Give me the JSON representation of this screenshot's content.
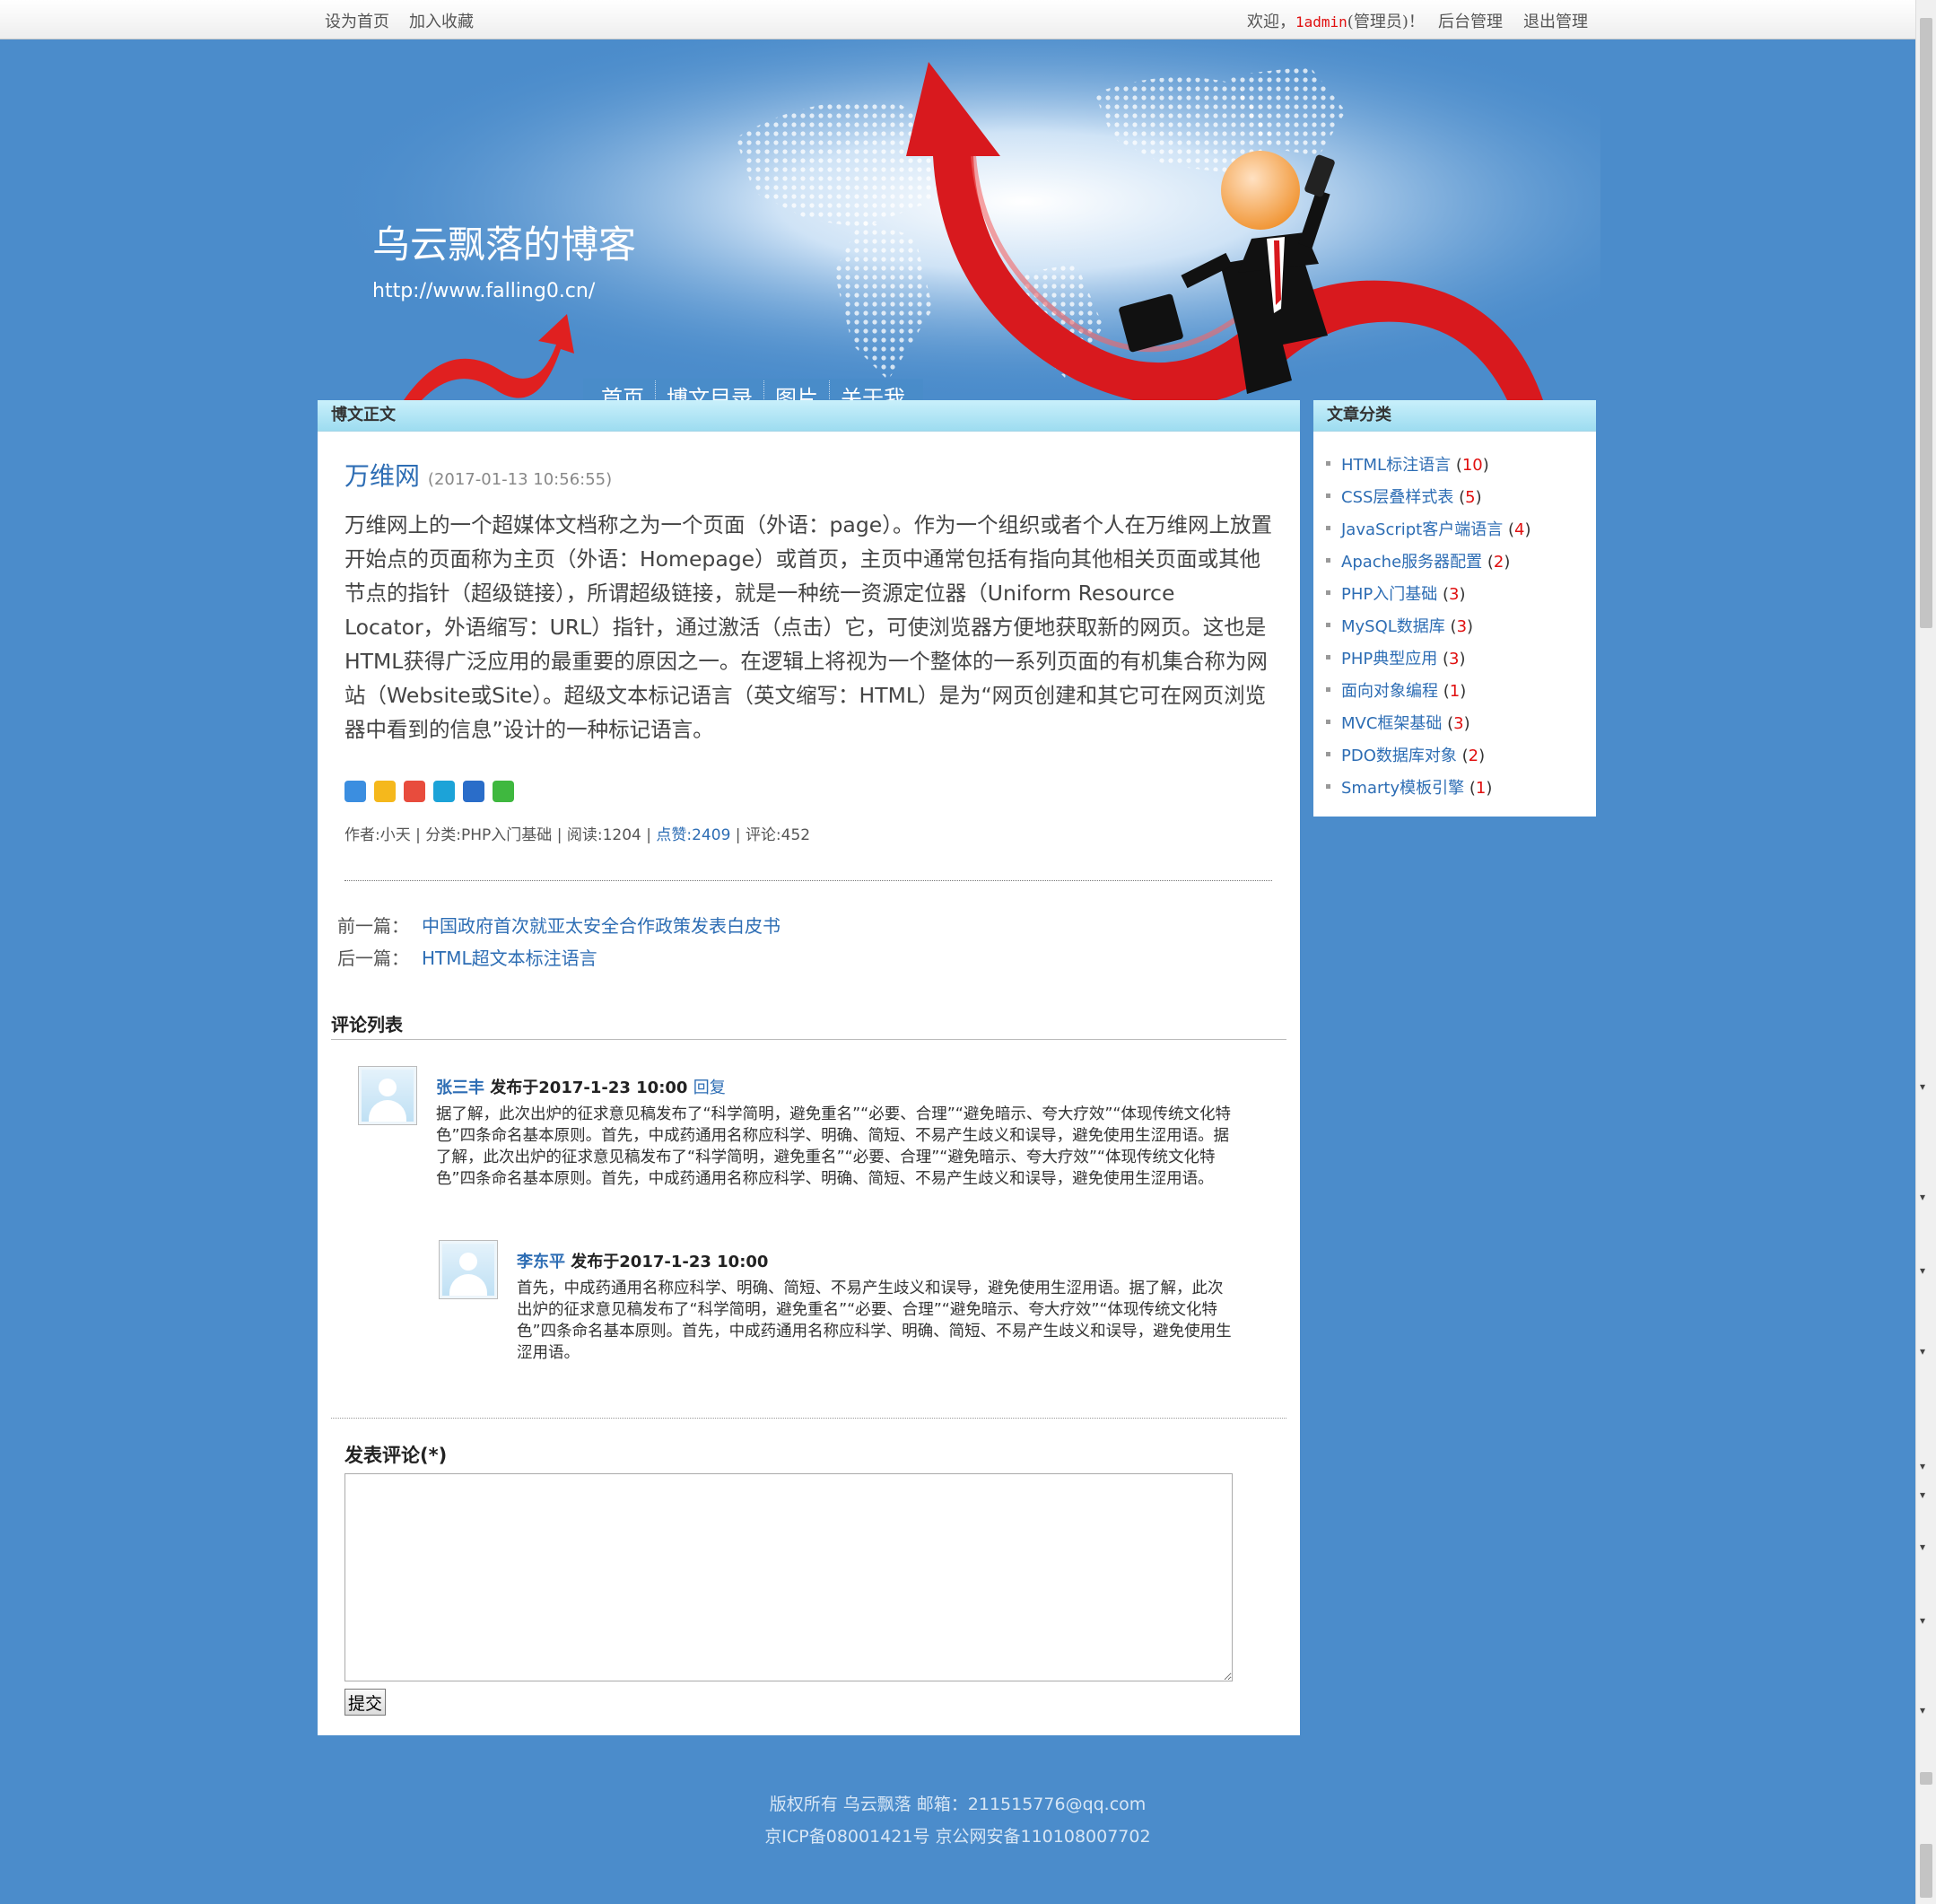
{
  "topbar": {
    "set_home": "设为首页",
    "add_fav": "加入收藏",
    "welcome_prefix": "欢迎，",
    "admin_name": "1admin",
    "welcome_suffix": "(管理员)！",
    "backend": "后台管理",
    "logout": "退出管理"
  },
  "banner": {
    "title": "乌云飘落的博客",
    "url": "http://www.falling0.cn/"
  },
  "nav": [
    "首页",
    "博文目录",
    "图片",
    "关于我"
  ],
  "main": {
    "panel_title": "博文正文",
    "article": {
      "title": "万维网",
      "date": "(2017-01-13 10:56:55)",
      "body": "万维网上的一个超媒体文档称之为一个页面（外语：page）。作为一个组织或者个人在万维网上放置开始点的页面称为主页（外语：Homepage）或首页，主页中通常包括有指向其他相关页面或其他节点的指针（超级链接），所谓超级链接，就是一种统一资源定位器（Uniform Resource Locator，外语缩写：URL）指针，通过激活（点击）它，可使浏览器方便地获取新的网页。这也是HTML获得广泛应用的最重要的原因之一。在逻辑上将视为一个整体的一系列页面的有机集合称为网站（Website或Site）。超级文本标记语言（英文缩写：HTML）是为“网页创建和其它可在网页浏览器中看到的信息”设计的一种标记语言。"
    },
    "share_icons": [
      {
        "name": "share-more-icon",
        "color": "#3b8ee0"
      },
      {
        "name": "share-qzone-icon",
        "color": "#f5b81c"
      },
      {
        "name": "share-weibo-icon",
        "color": "#e84c3d"
      },
      {
        "name": "share-tqq-icon",
        "color": "#1ca3d8"
      },
      {
        "name": "share-renren-icon",
        "color": "#2a6dc9"
      },
      {
        "name": "share-wechat-icon",
        "color": "#3fb83f"
      }
    ],
    "meta": {
      "author": "作者:小天",
      "category": "分类:PHP入门基础",
      "reads": "阅读:1204",
      "likes": "点赞:2409",
      "comments": "评论:452",
      "sep": " | "
    },
    "prev_label": "前一篇：",
    "prev_link": "中国政府首次就亚太安全合作政策发表白皮书",
    "next_label": "后一篇：",
    "next_link": "HTML超文本标注语言",
    "comments_title": "评论列表",
    "comments": [
      {
        "name": "张三丰",
        "posted": "发布于2017-1-23 10:00",
        "reply": "回复",
        "text": "据了解，此次出炉的征求意见稿发布了“科学简明，避免重名”“必要、合理”“避免暗示、夸大疗效”“体现传统文化特色”四条命名基本原则。首先，中成药通用名称应科学、明确、简短、不易产生歧义和误导，避免使用生涩用语。据了解，此次出炉的征求意见稿发布了“科学简明，避免重名”“必要、合理”“避免暗示、夸大疗效”“体现传统文化特色”四条命名基本原则。首先，中成药通用名称应科学、明确、简短、不易产生歧义和误导，避免使用生涩用语。"
      },
      {
        "name": "李东平",
        "posted": "发布于2017-1-23 10:00",
        "text": "首先，中成药通用名称应科学、明确、简短、不易产生歧义和误导，避免使用生涩用语。据了解，此次出炉的征求意见稿发布了“科学简明，避免重名”“必要、合理”“避免暗示、夸大疗效”“体现传统文化特色”四条命名基本原则。首先，中成药通用名称应科学、明确、简短、不易产生歧义和误导，避免使用生涩用语。"
      }
    ],
    "post_comment_title": "发表评论(*)",
    "submit_label": "提交"
  },
  "sidebar": {
    "title": "文章分类",
    "categories": [
      {
        "label": "HTML标注语言",
        "count": "10"
      },
      {
        "label": "CSS层叠样式表",
        "count": "5"
      },
      {
        "label": "JavaScript客户端语言",
        "count": "4"
      },
      {
        "label": "Apache服务器配置",
        "count": "2"
      },
      {
        "label": "PHP入门基础",
        "count": "3"
      },
      {
        "label": "MySQL数据库",
        "count": "3"
      },
      {
        "label": "PHP典型应用",
        "count": "3"
      },
      {
        "label": "面向对象编程",
        "count": "1"
      },
      {
        "label": "MVC框架基础",
        "count": "3"
      },
      {
        "label": "PDO数据库对象",
        "count": "2"
      },
      {
        "label": "Smarty模板引擎",
        "count": "1"
      }
    ]
  },
  "footer": {
    "line1": "版权所有 乌云飘落    邮箱：211515776@qq.com",
    "line2": "京ICP备08001421号 京公网安备110108007702"
  },
  "colors": {
    "page_bg": "#4b8ccb",
    "link": "#2d6db4",
    "count": "#e01010",
    "panel_head": "#9ddcf0"
  }
}
